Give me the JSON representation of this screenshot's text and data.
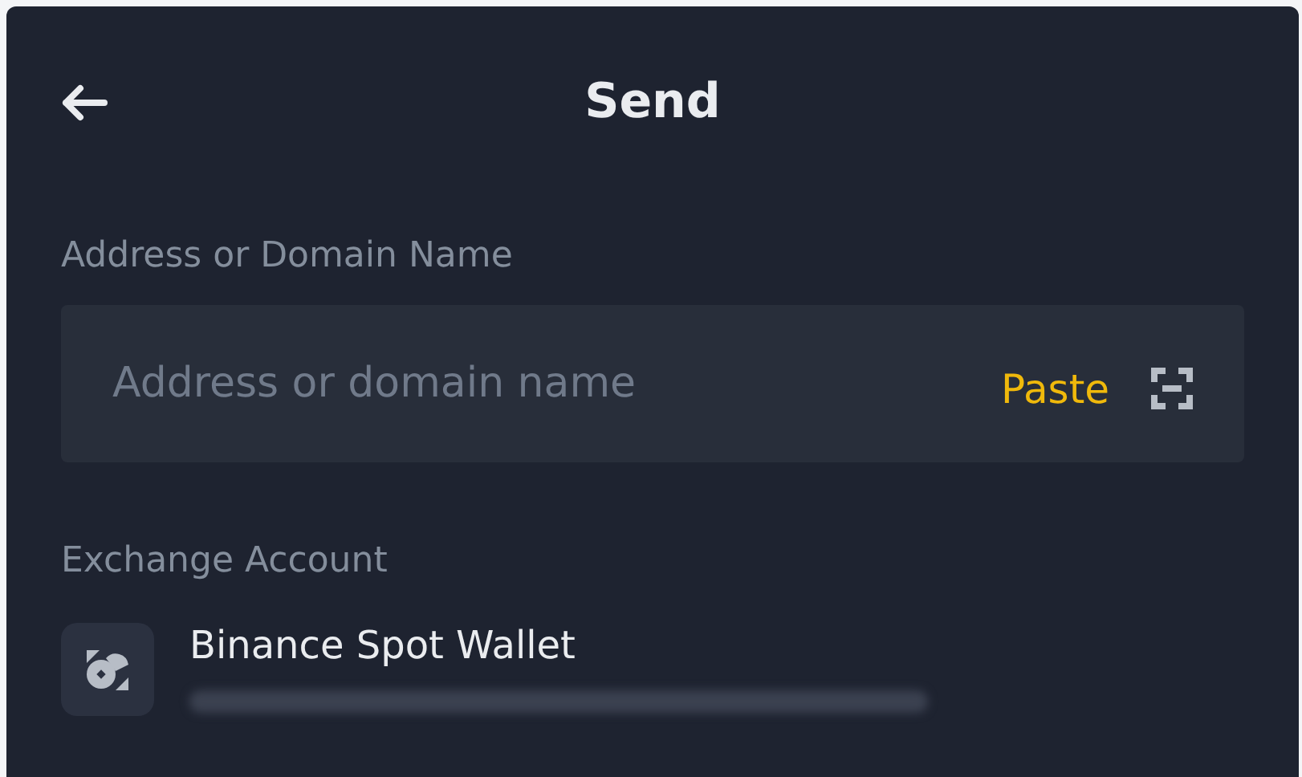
{
  "header": {
    "title": "Send"
  },
  "address": {
    "label": "Address or Domain Name",
    "placeholder": "Address or domain name",
    "paste": "Paste"
  },
  "exchange": {
    "label": "Exchange Account",
    "accounts": [
      {
        "name": "Binance Spot Wallet"
      }
    ]
  }
}
